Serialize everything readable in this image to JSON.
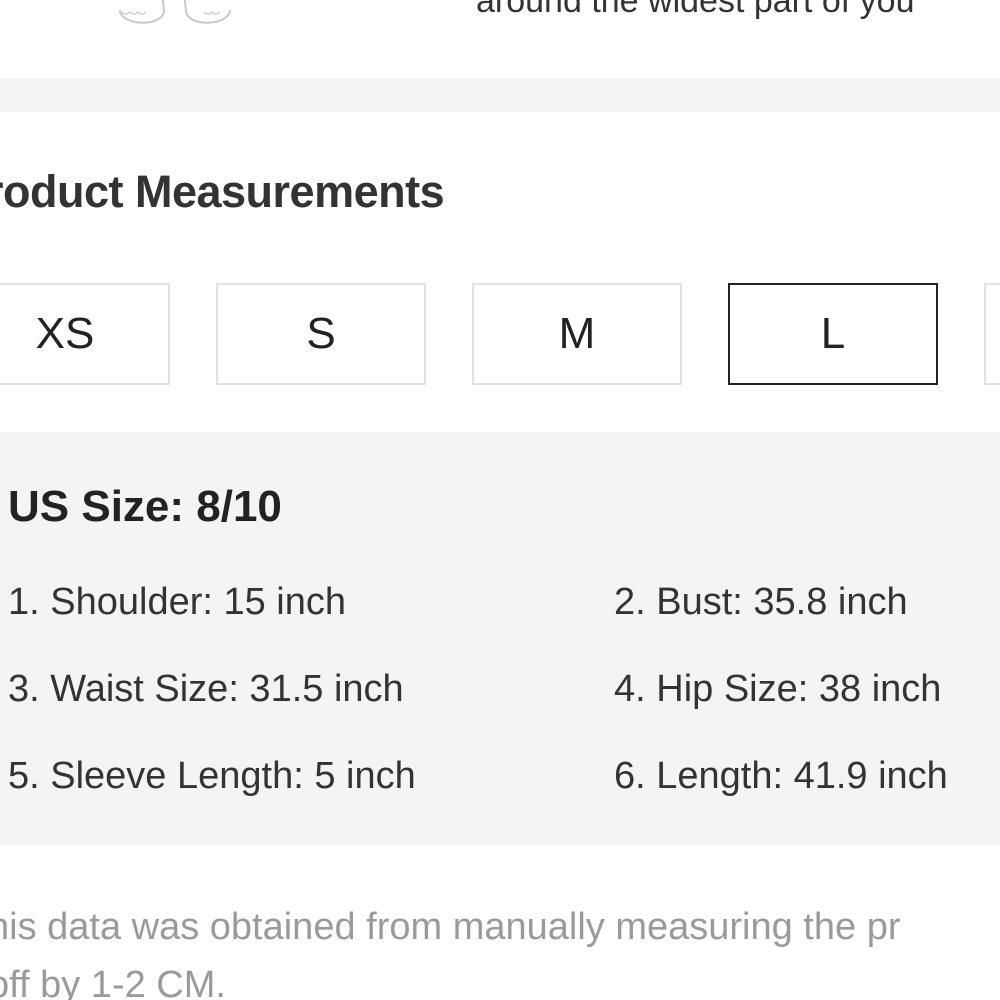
{
  "top": {
    "guide_text": "around the widest part of you"
  },
  "section": {
    "title": "roduct Measurements"
  },
  "sizes": [
    {
      "label": "XS",
      "selected": false
    },
    {
      "label": "S",
      "selected": false
    },
    {
      "label": "M",
      "selected": false
    },
    {
      "label": "L",
      "selected": true
    }
  ],
  "details": {
    "us_size": "US Size: 8/10",
    "measurements": [
      "1. Shoulder: 15 inch",
      "2. Bust: 35.8 inch",
      "3. Waist Size: 31.5 inch",
      "4. Hip Size: 38 inch",
      "5. Sleeve Length: 5 inch",
      "6. Length: 41.9 inch"
    ]
  },
  "disclaimer": {
    "line1": "his data was obtained from manually measuring the pr",
    "line2": " off by 1-2 CM."
  },
  "colors": {
    "panel_bg": "#f4f4f4",
    "selected_border": "#222222",
    "unselected_border": "#e2e2e2",
    "muted_text": "#9a9a9a"
  }
}
